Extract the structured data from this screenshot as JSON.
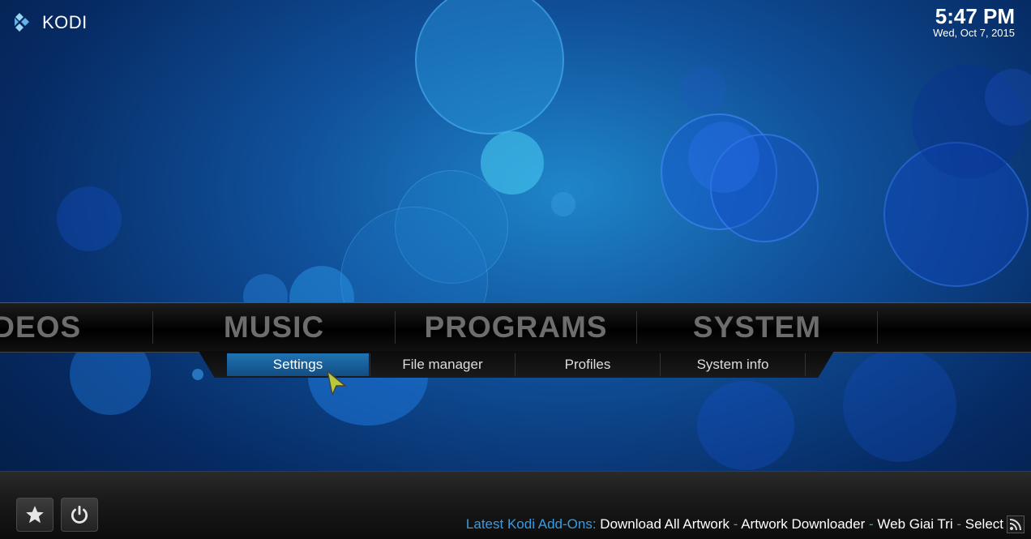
{
  "app": {
    "logo_text": "KODI"
  },
  "clock": {
    "time": "5:47 PM",
    "date": "Wed, Oct 7, 2015"
  },
  "main_menu": {
    "items": [
      "IDEOS",
      "MUSIC",
      "PROGRAMS",
      "SYSTEM"
    ]
  },
  "sub_menu": {
    "items": [
      "Settings",
      "File manager",
      "Profiles",
      "System info"
    ],
    "selected": "Settings"
  },
  "footer": {
    "favourites_icon": "star-icon",
    "power_icon": "power-icon",
    "rss_icon": "rss-icon",
    "ticker": {
      "lead": "Latest Kodi Add-Ons:",
      "items": [
        "Download All Artwork",
        "Artwork Downloader",
        "Web Giai Tri",
        "Select"
      ],
      "separator": "-"
    }
  },
  "colors": {
    "accent": "#3a9be0",
    "selected": "#1f73b3",
    "menu_text": "#6d6d6d"
  }
}
